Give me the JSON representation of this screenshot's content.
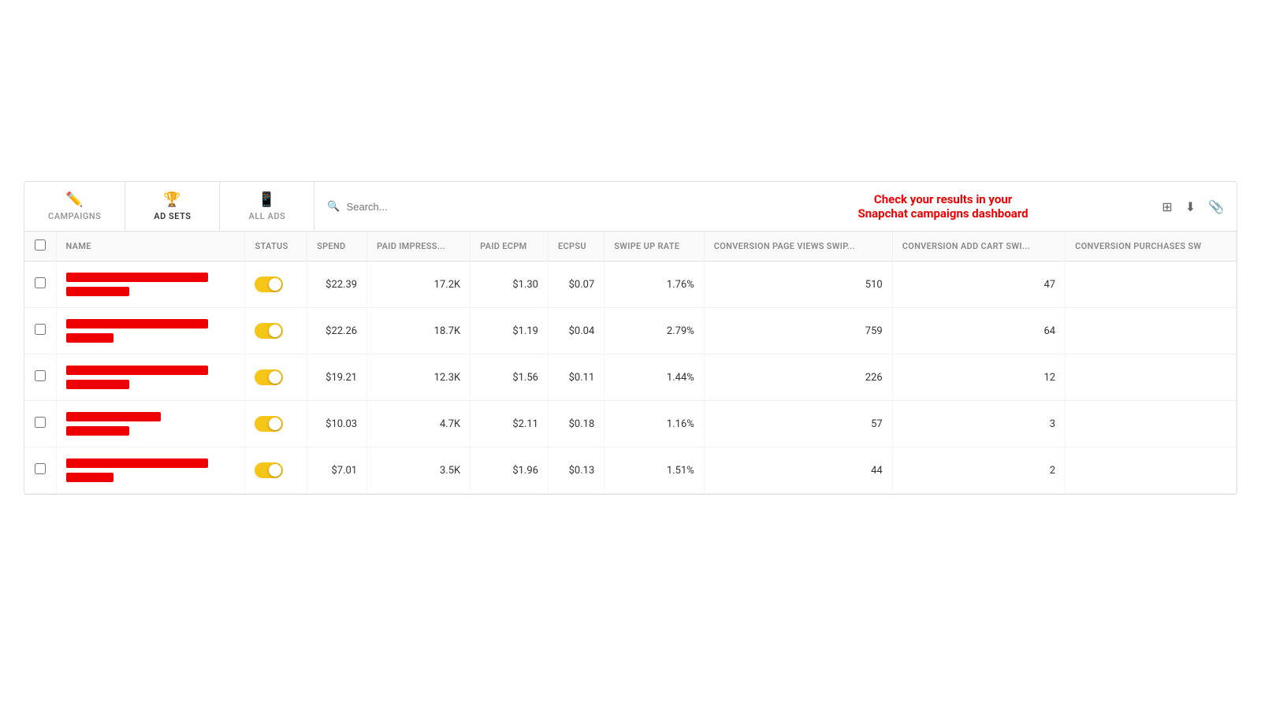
{
  "nav": {
    "tabs": [
      {
        "id": "campaigns",
        "label": "CAMPAIGNS",
        "icon": "✏",
        "active": false
      },
      {
        "id": "adsets",
        "label": "AD SETS",
        "icon": "🏆",
        "active": true
      },
      {
        "id": "allads",
        "label": "ALL ADS",
        "icon": "📱",
        "active": false
      }
    ]
  },
  "search": {
    "placeholder": "Search..."
  },
  "banner": {
    "line1": "Check your results in your",
    "line2": "Snapchat campaigns dashboard"
  },
  "toolbar": {
    "columns_icon": "|||",
    "download_icon": "⬇",
    "clip_icon": "📎"
  },
  "table": {
    "columns": [
      {
        "id": "check",
        "label": ""
      },
      {
        "id": "name",
        "label": "NAME"
      },
      {
        "id": "status",
        "label": "STATUS"
      },
      {
        "id": "spend",
        "label": "SPEND"
      },
      {
        "id": "paid_impressions",
        "label": "PAID IMPRESS..."
      },
      {
        "id": "paid_ecpm",
        "label": "PAID ECPM"
      },
      {
        "id": "ecpsu",
        "label": "ECPSU"
      },
      {
        "id": "swipe_up_rate",
        "label": "SWIPE UP RATE"
      },
      {
        "id": "conv_page_views",
        "label": "CONVERSION PAGE VIEWS SWIP..."
      },
      {
        "id": "conv_add_cart",
        "label": "CONVERSION ADD CART SWI..."
      },
      {
        "id": "conv_purchases",
        "label": "CONVERSION PURCHASES SW"
      }
    ],
    "rows": [
      {
        "id": "row1",
        "name_bars": [
          "long",
          "short"
        ],
        "status_active": true,
        "spend": "$22.39",
        "paid_impressions": "17.2K",
        "paid_ecpm": "$1.30",
        "ecpsu": "$0.07",
        "swipe_up_rate": "1.76%",
        "conv_page_views": "510",
        "conv_add_cart": "47",
        "conv_purchases": ""
      },
      {
        "id": "row2",
        "name_bars": [
          "long",
          "xshort"
        ],
        "status_active": true,
        "spend": "$22.26",
        "paid_impressions": "18.7K",
        "paid_ecpm": "$1.19",
        "ecpsu": "$0.04",
        "swipe_up_rate": "2.79%",
        "conv_page_views": "759",
        "conv_add_cart": "64",
        "conv_purchases": ""
      },
      {
        "id": "row3",
        "name_bars": [
          "long",
          "short"
        ],
        "status_active": true,
        "spend": "$19.21",
        "paid_impressions": "12.3K",
        "paid_ecpm": "$1.56",
        "ecpsu": "$0.11",
        "swipe_up_rate": "1.44%",
        "conv_page_views": "226",
        "conv_add_cart": "12",
        "conv_purchases": ""
      },
      {
        "id": "row4",
        "name_bars": [
          "medium",
          "short"
        ],
        "status_active": true,
        "spend": "$10.03",
        "paid_impressions": "4.7K",
        "paid_ecpm": "$2.11",
        "ecpsu": "$0.18",
        "swipe_up_rate": "1.16%",
        "conv_page_views": "57",
        "conv_add_cart": "3",
        "conv_purchases": ""
      },
      {
        "id": "row5",
        "name_bars": [
          "long",
          "xshort"
        ],
        "status_active": true,
        "spend": "$7.01",
        "paid_impressions": "3.5K",
        "paid_ecpm": "$1.96",
        "ecpsu": "$0.13",
        "swipe_up_rate": "1.51%",
        "conv_page_views": "44",
        "conv_add_cart": "2",
        "conv_purchases": ""
      }
    ]
  }
}
